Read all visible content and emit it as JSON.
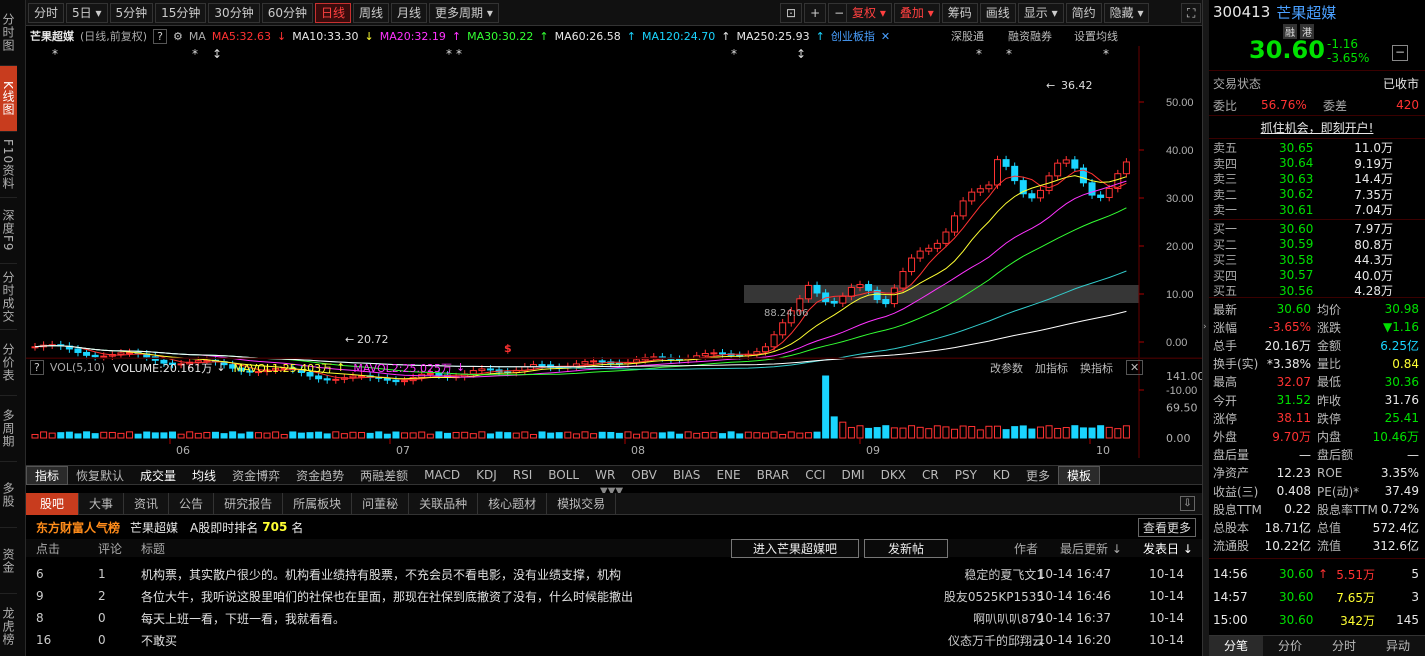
{
  "left_nav": [
    "分时图",
    "K线图",
    "F10资料",
    "深度F9",
    "分时成交",
    "分价表",
    "多周期",
    "多股",
    "资金",
    "龙虎榜"
  ],
  "toolbar": {
    "periods": [
      "分时",
      "5日",
      "5分钟",
      "15分钟",
      "30分钟",
      "60分钟",
      "日线",
      "周线",
      "月线",
      "更多周期"
    ],
    "active": "日线",
    "right": [
      "复权",
      "叠加",
      "筹码",
      "画线",
      "显示",
      "简约",
      "隐藏"
    ]
  },
  "ma": {
    "name": "芒果超媒",
    "mode": "(日线,前复权)",
    "label": "MA",
    "ma5": "MA5:32.63",
    "ma10": "MA10:33.30",
    "ma20": "MA20:32.19",
    "ma30": "MA30:30.22",
    "ma60": "MA60:26.58",
    "ma120": "MA120:24.70",
    "ma250": "MA250:25.93",
    "newhigh": "创业板指",
    "links": [
      "深股通",
      "融资融券",
      "设置均线"
    ]
  },
  "price_axis": [
    "50.00",
    "40.00",
    "30.00",
    "20.00",
    "10.00",
    "0.00",
    "-10.00"
  ],
  "annotations": {
    "high": "36.42",
    "low": "20.72",
    "mid": "88.24.06"
  },
  "vol": {
    "label": "VOL(5,10)",
    "volume": "VOLUME:20.161万",
    "mavol1": "MAVOL1:25.403万",
    "mavol2": "MAVOL2:25.025万",
    "links": [
      "改参数",
      "加指标",
      "换指标"
    ],
    "axis": [
      "141.00",
      "69.50",
      "0.00"
    ]
  },
  "months": [
    "06",
    "07",
    "08",
    "09",
    "10"
  ],
  "indicators": {
    "items": [
      "指标",
      "恢复默认",
      "成交量",
      "均线",
      "资金博弈",
      "资金趋势",
      "两融差额",
      "MACD",
      "KDJ",
      "RSI",
      "BOLL",
      "WR",
      "OBV",
      "BIAS",
      "ENE",
      "BRAR",
      "CCI",
      "DMI",
      "DKX",
      "CR",
      "PSY",
      "KD",
      "更多",
      "模板"
    ]
  },
  "news": {
    "tabs": [
      "股吧",
      "大事",
      "资讯",
      "公告",
      "研究报告",
      "所属板块",
      "问董秘",
      "关联品种",
      "核心题材",
      "模拟交易"
    ],
    "hot_title": "东方财富人气榜",
    "hot_stock": "芒果超媒",
    "rank_label": "A股即时排名",
    "rank": "705",
    "rank_unit": "名",
    "more": "查看更多",
    "headers": {
      "click": "点击",
      "comment": "评论",
      "title": "标题",
      "enter": "进入芒果超媒吧",
      "post": "发新帖",
      "author": "作者",
      "updated": "最后更新",
      "published": "发表日"
    },
    "rows": [
      {
        "click": "6",
        "comment": "1",
        "title": "机构票，其实散户很少的。机构看业绩持有股票，不充会员不看电影，没有业绩支撑，机构",
        "author": "稳定的夏飞文1",
        "updated": "10-14 16:47",
        "published": "10-14"
      },
      {
        "click": "9",
        "comment": "2",
        "title": "各位大牛，我听说这股里咱们的社保也在里面，那现在社保到底撤资了没有，什么时候能撤出",
        "author": "股友0525KP1535",
        "updated": "10-14 16:46",
        "published": "10-14"
      },
      {
        "click": "8",
        "comment": "0",
        "title": "每天上班一看，下班一看，我就看看。",
        "author": "啊叭叭叭879",
        "updated": "10-14 16:37",
        "published": "10-14"
      },
      {
        "click": "16",
        "comment": "0",
        "title": "不敢买",
        "author": "仪态万千的邱翔云",
        "updated": "10-14 16:20",
        "published": "10-14"
      }
    ]
  },
  "quote": {
    "code": "300413",
    "name": "芒果超媒",
    "tags": [
      "融",
      "港"
    ],
    "price": "30.60",
    "change": "-1.16",
    "pct": "-3.65%",
    "status_label": "交易状态",
    "status": "已收市",
    "wb_label": "委比",
    "wb": "56.76%",
    "wc_label": "委差",
    "wc": "420",
    "promo": "抓住机会，即刻开户!",
    "asks": [
      {
        "l": "卖五",
        "p": "30.65",
        "v": "11.0万"
      },
      {
        "l": "卖四",
        "p": "30.64",
        "v": "9.19万"
      },
      {
        "l": "卖三",
        "p": "30.63",
        "v": "14.4万"
      },
      {
        "l": "卖二",
        "p": "30.62",
        "v": "7.35万"
      },
      {
        "l": "卖一",
        "p": "30.61",
        "v": "7.04万"
      }
    ],
    "bids": [
      {
        "l": "买一",
        "p": "30.60",
        "v": "7.97万"
      },
      {
        "l": "买二",
        "p": "30.59",
        "v": "80.8万"
      },
      {
        "l": "买三",
        "p": "30.58",
        "v": "44.3万"
      },
      {
        "l": "买四",
        "p": "30.57",
        "v": "40.0万"
      },
      {
        "l": "买五",
        "p": "30.56",
        "v": "4.28万"
      }
    ],
    "stats": [
      [
        "最新",
        "30.60",
        "g",
        "均价",
        "30.98",
        "g"
      ],
      [
        "涨幅",
        "-3.65%",
        "r",
        "涨跌",
        "▼1.16",
        "g"
      ],
      [
        "总手",
        "20.16万",
        "w",
        "金额",
        "6.25亿",
        "c"
      ],
      [
        "换手(实)",
        "*3.38%",
        "w",
        "量比",
        "0.84",
        "y"
      ],
      [
        "最高",
        "32.07",
        "r",
        "最低",
        "30.36",
        "g"
      ],
      [
        "今开",
        "31.52",
        "g",
        "昨收",
        "31.76",
        "w"
      ],
      [
        "涨停",
        "38.11",
        "r",
        "跌停",
        "25.41",
        "g"
      ],
      [
        "外盘",
        "9.70万",
        "r",
        "内盘",
        "10.46万",
        "g"
      ],
      [
        "盘后量",
        "—",
        "w",
        "盘后额",
        "—",
        "w"
      ],
      [
        "净资产",
        "12.23",
        "w",
        "ROE",
        "3.35%",
        "w"
      ],
      [
        "收益(三)",
        "0.408",
        "w",
        "PE(动)*",
        "37.49",
        "w"
      ],
      [
        "股息TTM",
        "0.22",
        "w",
        "股息率TTM",
        "0.72%",
        "w"
      ],
      [
        "总股本",
        "18.71亿",
        "w",
        "总值",
        "572.4亿",
        "w"
      ],
      [
        "流通股",
        "10.22亿",
        "w",
        "流值",
        "312.6亿",
        "w"
      ]
    ],
    "ticks": [
      {
        "t": "14:56",
        "p": "30.60",
        "v": "5.51万",
        "n": "5",
        "up": true
      },
      {
        "t": "14:57",
        "p": "30.60",
        "v": "7.65万",
        "n": "3",
        "up": false
      },
      {
        "t": "15:00",
        "p": "30.60",
        "v": "342万",
        "n": "145",
        "up": false
      }
    ],
    "bottom_tabs": [
      "分笔",
      "分价",
      "分时",
      "异动"
    ]
  },
  "colors": {
    "up": "#ff3232",
    "down": "#1ad5ff",
    "ma5": "#ff3232",
    "ma10": "#ffff33",
    "ma20": "#ff33ff",
    "ma30": "#33ff33",
    "ma120": "#33cccc",
    "ma250": "#ffffff"
  }
}
